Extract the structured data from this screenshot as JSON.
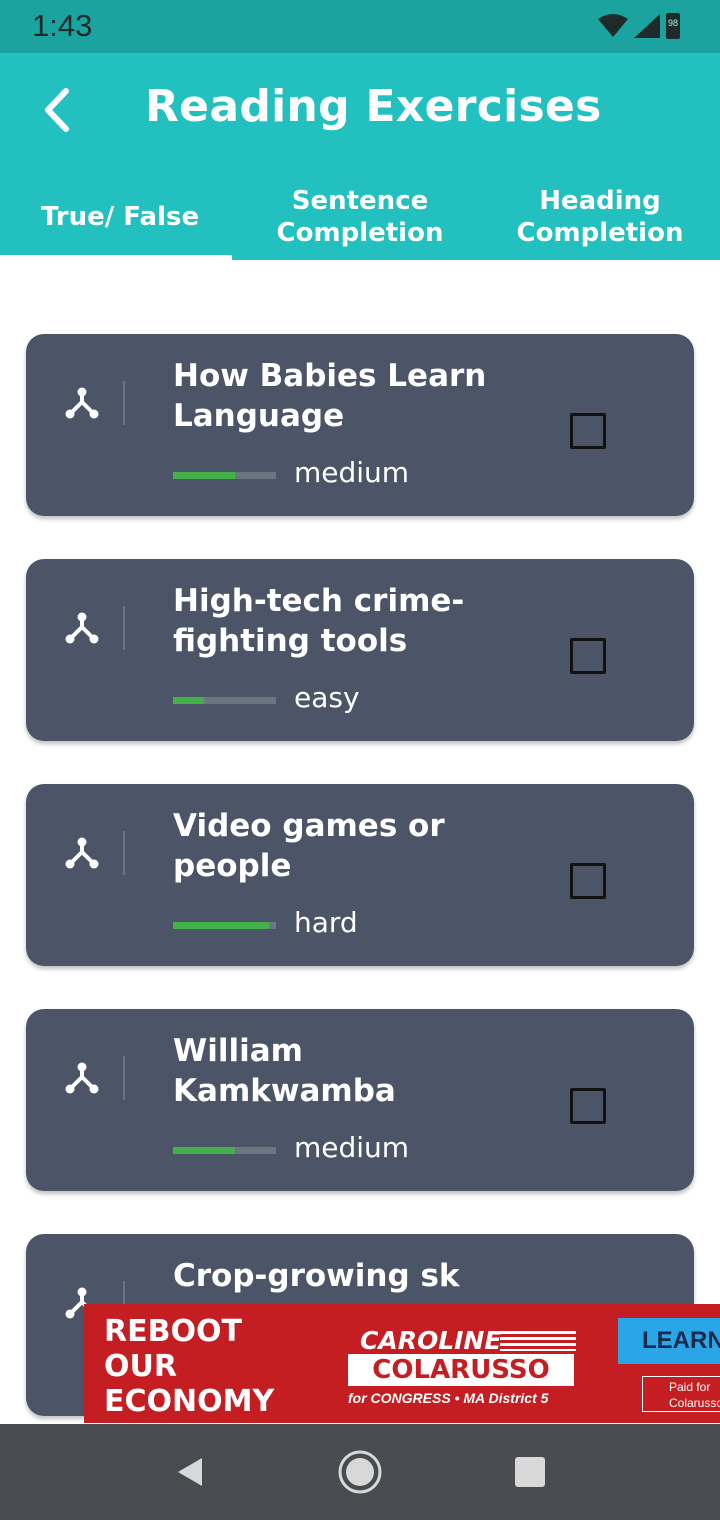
{
  "status_bar": {
    "time": "1:43",
    "battery_level": "98",
    "icons": [
      "wifi-icon",
      "signal-icon",
      "battery-icon"
    ]
  },
  "header": {
    "title": "Reading Exercises",
    "back_icon": "back-arrow-icon",
    "background": "#22c0bf"
  },
  "tabs": [
    {
      "label": "True/ False",
      "active": true
    },
    {
      "label": "Sentence\nCompletion",
      "active": false
    },
    {
      "label": "Heading\nCompletion",
      "active": false
    }
  ],
  "exercises": [
    {
      "title": "How Babies Learn Language",
      "level": "medium",
      "level_fraction": 0.6,
      "checked": false
    },
    {
      "title": "High-tech crime-fighting tools",
      "level": "easy",
      "level_fraction": 0.3,
      "checked": false
    },
    {
      "title": "Video games or people",
      "level": "hard",
      "level_fraction": 0.93,
      "checked": false
    },
    {
      "title": "William Kamkwamba",
      "level": "medium",
      "level_fraction": 0.6,
      "checked": false
    },
    {
      "title": "Crop-growing sk",
      "level": "",
      "level_fraction": 0,
      "checked": false
    }
  ],
  "ad": {
    "headline": "REBOOT\nOUR\nECONOMY",
    "brand_top": "CAROLINE",
    "brand_name": "COLARUSSO",
    "brand_sub": "for CONGRESS • MA District 5",
    "cta": "LEARN",
    "paid": "Paid for\nColarusso"
  },
  "nav": {
    "back": "back-triangle-icon",
    "home": "home-circle-icon",
    "recents": "recents-square-icon"
  },
  "colors": {
    "card": "#4b5567",
    "level_fill": "#43b04a",
    "ad": "#c41e22",
    "nav": "#484c51"
  }
}
